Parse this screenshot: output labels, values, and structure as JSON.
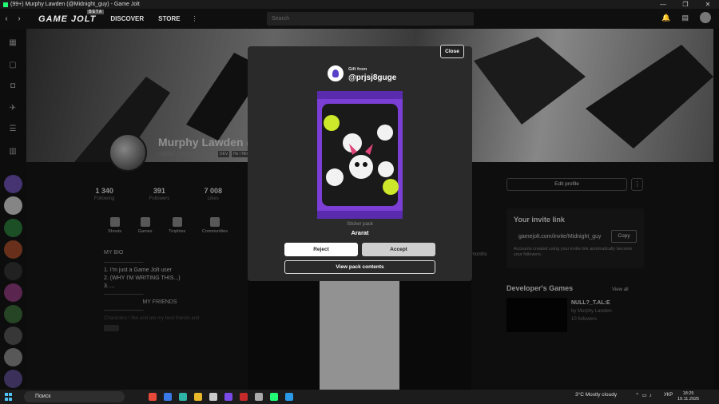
{
  "window": {
    "title": "(99+) Murphy Lawden (@Midnight_guy) - Game Jolt",
    "controls": [
      "—",
      "❐",
      "✕"
    ]
  },
  "nav": {
    "logo": "GAME JOLT",
    "beta": "BETA",
    "discover": "DISCOVER",
    "store": "STORE",
    "more": "⋮",
    "search_placeholder": "Search"
  },
  "profile": {
    "name": "Murphy Lawden @",
    "joined": "Joined 7 months ago",
    "tags": [
      "DEV",
      "He / Him"
    ],
    "stats": [
      {
        "value": "1 340",
        "label": "Following"
      },
      {
        "value": "391",
        "label": "Followers"
      },
      {
        "value": "7 008",
        "label": "Likes"
      }
    ],
    "actions": [
      {
        "label": "Shouts"
      },
      {
        "label": "Games"
      },
      {
        "label": "Trophies"
      },
      {
        "label": "Communities"
      }
    ],
    "bio_title": "MY BIO",
    "bio_lines": [
      "1. I'm just a Game Jolt user",
      "2. (WHY I'M WRITING THIS...)",
      "3. ..."
    ],
    "friends_title": "MY FRIENDS",
    "friends_line": "Characters I like and are my best friends and"
  },
  "right": {
    "edit_profile": "Edit profile",
    "more": "⋮",
    "invite_title": "Your invite link",
    "invite_link": "gamejolt.com/invite/Midnight_guy",
    "copy": "Copy",
    "invite_note": "Accounts created using your invite link automatically become your followers.",
    "dev_title": "Developer's Games",
    "view_all": "View all",
    "game": {
      "name": "NULL?_T.AL:E",
      "by": "by Murphy Lawden",
      "followers": "10 followers"
    }
  },
  "feed": {
    "months": "months"
  },
  "modal": {
    "close": "Close",
    "gift_from": "Gift from",
    "gift_user": "@prjsj8guge",
    "pack_type": "Sticker pack",
    "pack_name": "Ararat",
    "reject": "Reject",
    "accept": "Accept",
    "view_pack": "View pack contents"
  },
  "taskbar": {
    "search": "Поиск",
    "weather": "3°C  Mostly cloudy",
    "lang": "УКР",
    "time": "18:25",
    "date": "19.11.2025"
  }
}
